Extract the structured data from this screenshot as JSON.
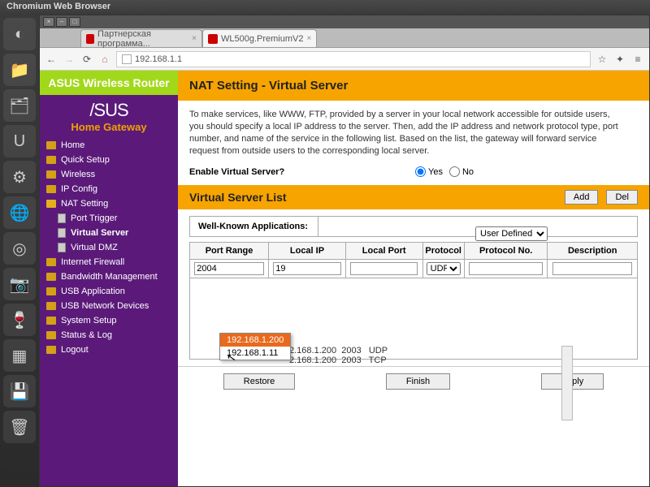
{
  "os_title": "Chromium Web Browser",
  "dock": [
    "◐",
    "📁",
    "🗂",
    "U",
    "⚙",
    "🌐",
    "◎",
    "📷",
    "🍷",
    "▦",
    "💾",
    "🗑"
  ],
  "tabs": [
    {
      "label": "Партнерская программа...",
      "active": false
    },
    {
      "label": "WL500g.PremiumV2",
      "active": true
    }
  ],
  "url": "192.168.1.1",
  "brand": {
    "logo": "/SUS",
    "sub": "Home Gateway"
  },
  "banner": "ASUS Wireless Router",
  "nav": [
    {
      "label": "Home",
      "type": "folder"
    },
    {
      "label": "Quick Setup",
      "type": "folder"
    },
    {
      "label": "Wireless",
      "type": "folder"
    },
    {
      "label": "IP Config",
      "type": "folder"
    },
    {
      "label": "NAT Setting",
      "type": "folder",
      "open": true
    },
    {
      "label": "Port Trigger",
      "type": "doc",
      "sub": true
    },
    {
      "label": "Virtual Server",
      "type": "doc",
      "sub": true,
      "active": true
    },
    {
      "label": "Virtual DMZ",
      "type": "doc",
      "sub": true
    },
    {
      "label": "Internet Firewall",
      "type": "folder"
    },
    {
      "label": "Bandwidth Management",
      "type": "folder"
    },
    {
      "label": "USB Application",
      "type": "folder"
    },
    {
      "label": "USB Network Devices",
      "type": "folder"
    },
    {
      "label": "System Setup",
      "type": "folder"
    },
    {
      "label": "Status & Log",
      "type": "folder"
    },
    {
      "label": "Logout",
      "type": "folder"
    }
  ],
  "page": {
    "title": "NAT Setting - Virtual Server",
    "desc": "To make services, like WWW, FTP, provided by a server in your local network accessible for outside users, you should specify a local IP address to the server. Then, add the IP address and network protocol type, port number, and name of the service in the following list. Based on the list, the gateway will forward service request from outside users to the corresponding local server.",
    "enable_label": "Enable Virtual Server?",
    "yes": "Yes",
    "no": "No",
    "section": "Virtual Server List",
    "add": "Add",
    "del": "Del",
    "wka_label": "Well-Known Applications:",
    "wka_value": "User Defined",
    "cols": [
      "Port Range",
      "Local IP",
      "Local Port",
      "Protocol",
      "Protocol No.",
      "Description"
    ],
    "row": {
      "port_range": "2004",
      "local_ip": "19",
      "local_port": "",
      "protocol": "UDP",
      "protocol_no": "",
      "desc": ""
    },
    "autocomplete": [
      "192.168.1.200",
      "192.168.1.11"
    ],
    "existing": [
      {
        "ip": "2.168.1.200",
        "port": "2003",
        "proto": "UDP"
      },
      {
        "ip": "2.168.1.200",
        "port": "2003",
        "proto": "TCP"
      }
    ],
    "footer": [
      "Restore",
      "Finish",
      "Apply"
    ]
  }
}
